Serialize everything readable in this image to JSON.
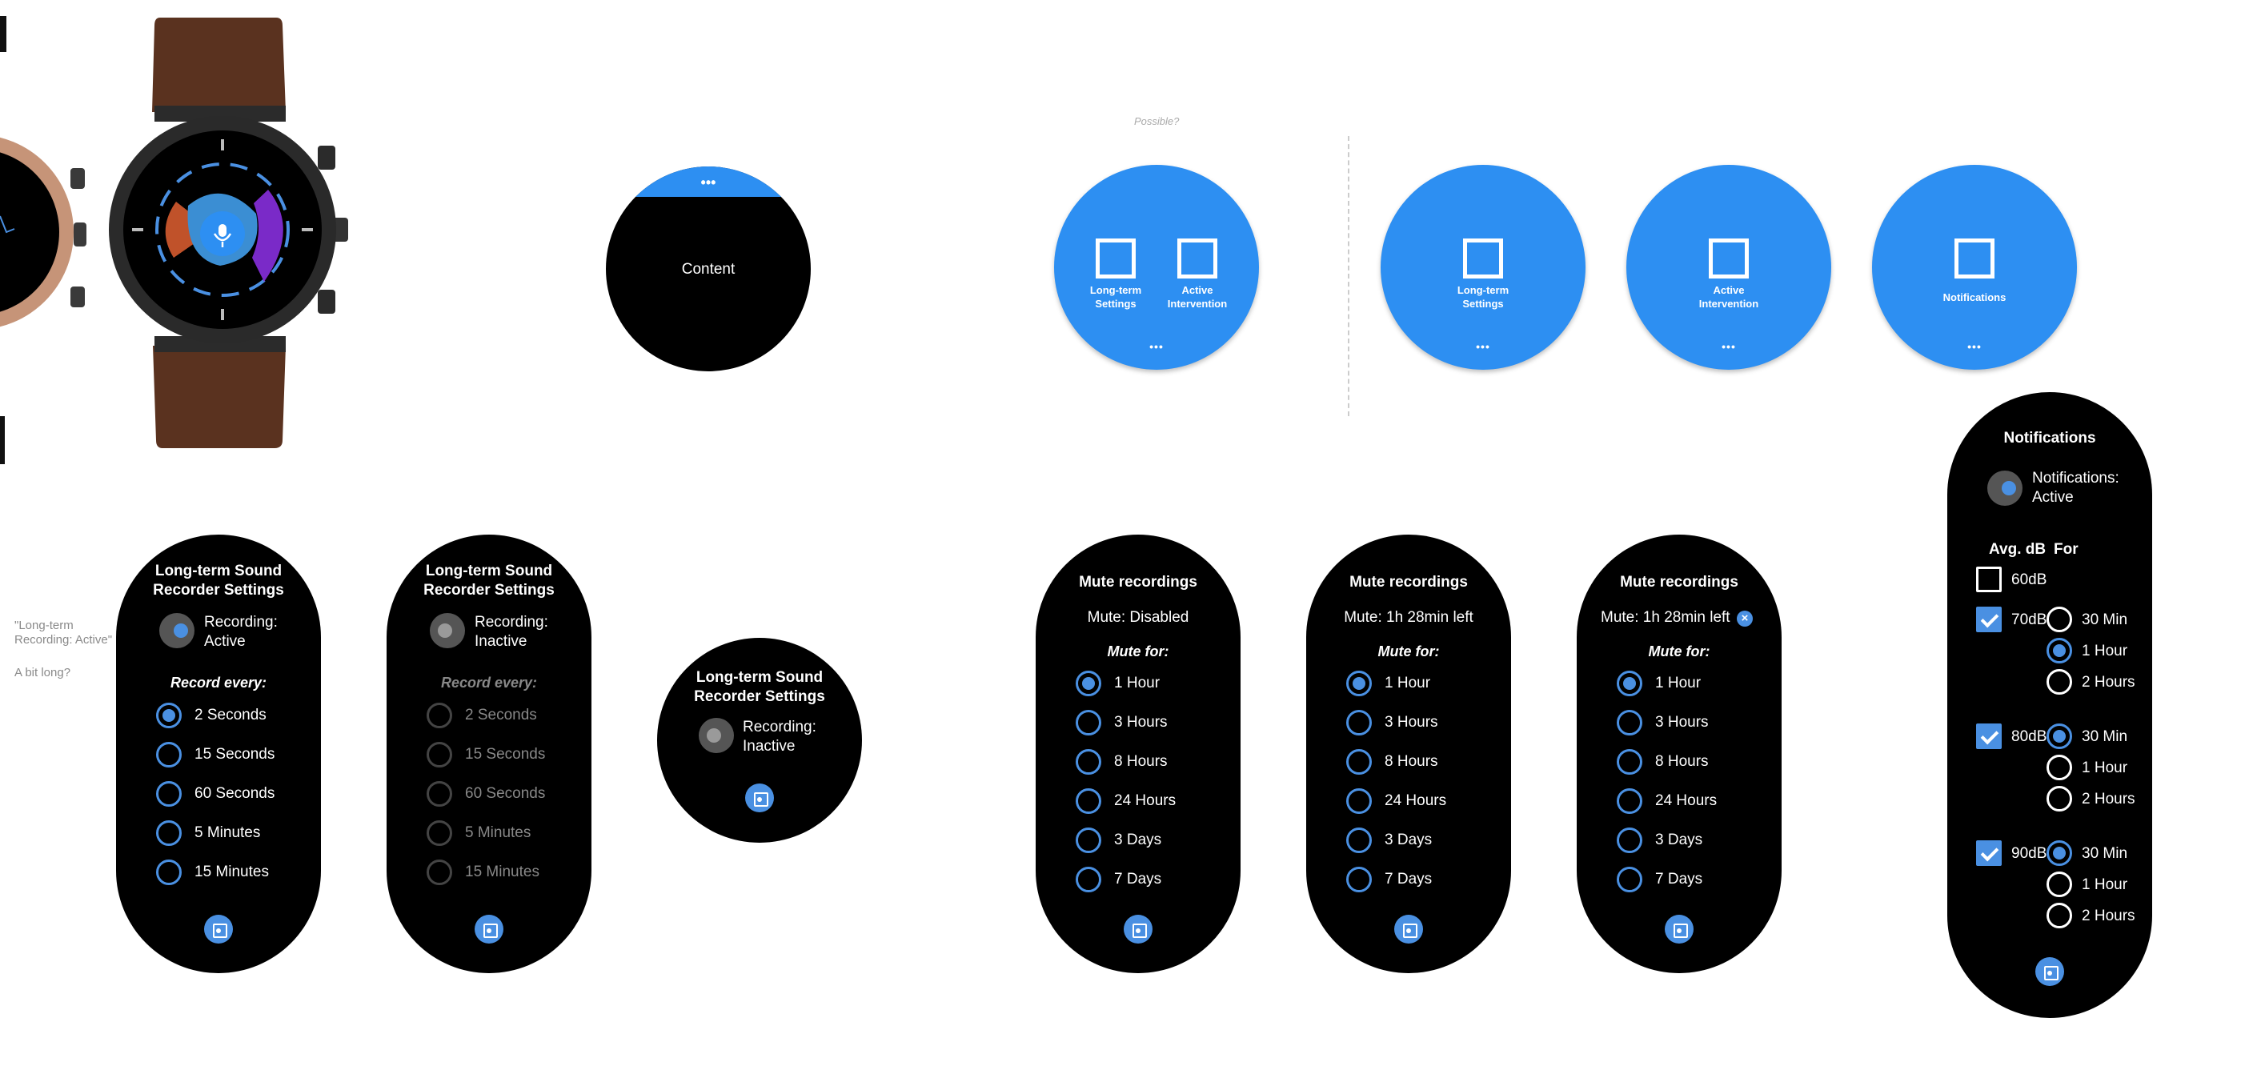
{
  "notes": {
    "possible": "Possible?",
    "lt_note_1": "\"Long-term",
    "lt_note_2": "Recording: Active\"",
    "a_bit_long": "A bit long?"
  },
  "template": {
    "top_dots": "•••",
    "content": "Content"
  },
  "tiles": {
    "long_term_1": "Long-term",
    "long_term_2": "Settings",
    "active_1": "Active",
    "active_2": "Intervention",
    "notifications": "Notifications",
    "dots": "•••"
  },
  "longterm": {
    "title_1": "Long-term Sound",
    "title_2": "Recorder Settings",
    "recording": "Recording:",
    "active": "Active",
    "inactive": "Inactive",
    "record_every": "Record every:",
    "options": [
      "2 Seconds",
      "15 Seconds",
      "60 Seconds",
      "5 Minutes",
      "15 Minutes"
    ],
    "selected_index": 0
  },
  "mute": {
    "title": "Mute recordings",
    "status_disabled": "Mute: Disabled",
    "status_left": "Mute: 1h 28min left",
    "mute_for": "Mute for:",
    "options": [
      "1 Hour",
      "3 Hours",
      "8 Hours",
      "24 Hours",
      "3 Days",
      "7 Days"
    ],
    "selected_index": 0
  },
  "notif": {
    "title": "Notifications",
    "status_1": "Notifications:",
    "status_2": "Active",
    "col_db": "Avg. dB",
    "col_for": "For",
    "levels": [
      {
        "label": "60dB",
        "checked": false
      },
      {
        "label": "70dB",
        "checked": true,
        "selected": 1
      },
      {
        "label": "80dB",
        "checked": true,
        "selected": 0
      },
      {
        "label": "90dB",
        "checked": true,
        "selected": 0
      }
    ],
    "durations": [
      "30 Min",
      "1 Hour",
      "2 Hours"
    ]
  },
  "colors": {
    "accent": "#4a90e2",
    "tile_blue": "#2d8ff2",
    "strap": "#5a321f"
  }
}
